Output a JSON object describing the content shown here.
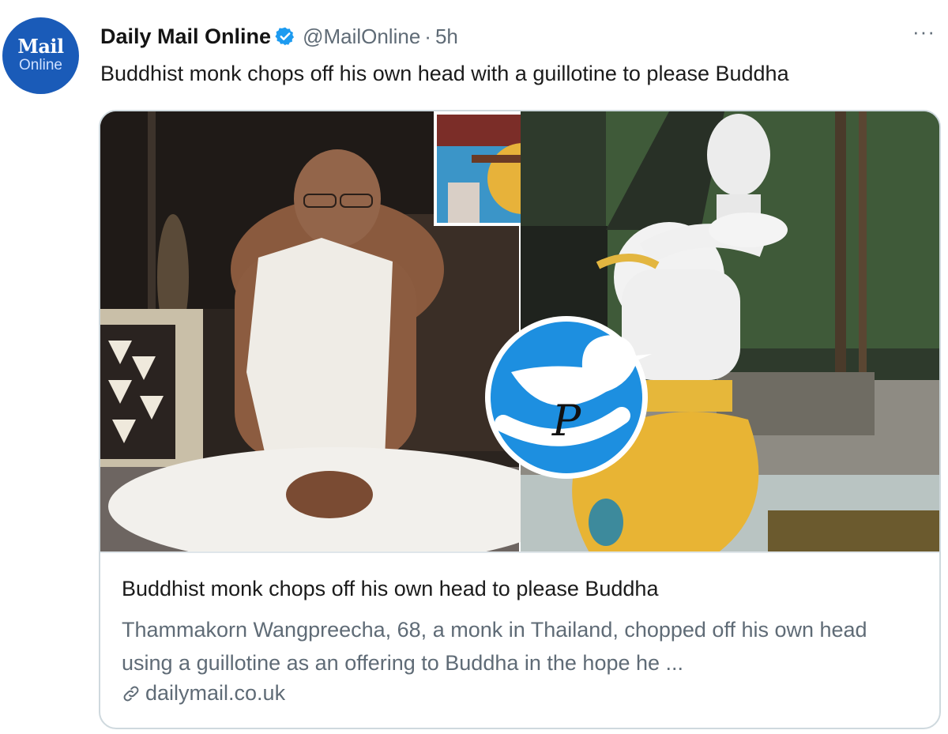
{
  "account": {
    "avatar_line1": "Mail",
    "avatar_line2": "Online",
    "display_name": "Daily Mail Online",
    "verified_icon": "verified-badge-icon",
    "handle": "@MailOnline",
    "separator": "·",
    "time": "5h",
    "more_icon": "more-options-icon",
    "more_glyph": "···"
  },
  "tweet": {
    "text": "Buddhist monk chops off his own head with a guillotine to please Buddha"
  },
  "card": {
    "title": "Buddhist monk chops off his own head to please Buddha",
    "description": "Thammakorn Wangpreecha, 68, a monk in Thailand, chopped off his own head using a guillotine as an offering to Buddha in the hope he ...",
    "link_icon": "link-icon",
    "domain": "dailymail.co.uk"
  },
  "watermark": {
    "icon": "twitter-bird-logo-icon",
    "letter": "P"
  },
  "colors": {
    "brand_blue": "#1a5bb8",
    "verified_blue": "#1d9bf0",
    "secondary_text": "#5f6b76",
    "border": "#cfd9de"
  }
}
